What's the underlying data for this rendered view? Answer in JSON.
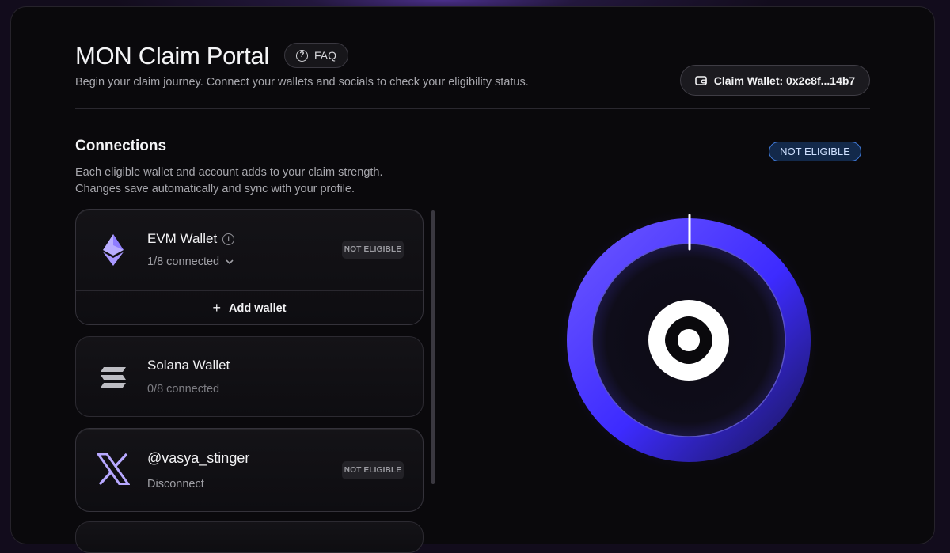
{
  "header": {
    "title": "MON Claim Portal",
    "faq_label": "FAQ",
    "subtitle": "Begin your claim journey. Connect your wallets and socials to check your eligibility status.",
    "claim_wallet_label": "Claim Wallet: 0x2c8f...14b7"
  },
  "connections": {
    "title": "Connections",
    "description_line1": "Each eligible wallet and account adds to your claim strength.",
    "description_line2": "Changes save automatically and sync with your profile.",
    "status": "NOT ELIGIBLE",
    "items": [
      {
        "name": "EVM Wallet",
        "sub": "1/8 connected",
        "badge": "NOT ELIGIBLE",
        "action": "Add wallet",
        "icon": "ethereum-icon"
      },
      {
        "name": "Solana Wallet",
        "sub": "0/8 connected",
        "icon": "solana-icon"
      },
      {
        "name": "@vasya_stinger",
        "sub": "Disconnect",
        "badge": "NOT ELIGIBLE",
        "icon": "x-logo-icon"
      }
    ]
  },
  "colors": {
    "accent": "#5b4bff",
    "badge_border": "#3f79d8",
    "background": "#0a090c"
  },
  "progress": {
    "fraction": 0.0
  }
}
